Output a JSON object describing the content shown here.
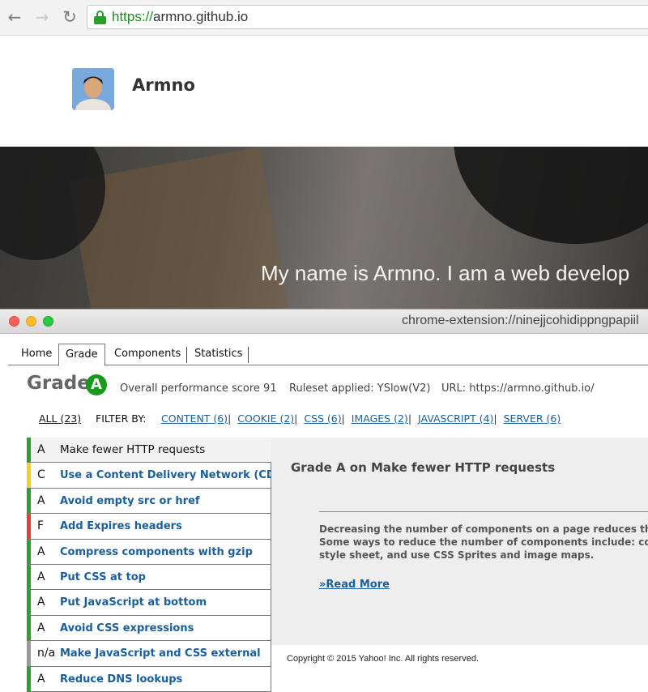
{
  "browser": {
    "url_scheme": "https://",
    "url_host": "armno.github.io",
    "back_icon": "arrow-left-icon",
    "forward_icon": "arrow-right-icon",
    "reload_icon": "reload-icon",
    "lock_icon": "lock-icon"
  },
  "site": {
    "name": "Armno",
    "hero_text": "My name is Armno. I am a web develop"
  },
  "popup": {
    "title": "chrome-extension://ninejjcohidippngpapiil",
    "tabs": [
      "Home",
      "Grade",
      "Components",
      "Statistics"
    ],
    "active_tab": "Grade"
  },
  "grade": {
    "label": "Grade",
    "letter": "A",
    "score_text": "Overall performance score 91",
    "ruleset_text": "Ruleset applied: YSlow(V2)",
    "url_text": "URL: https://armno.github.io/"
  },
  "filter": {
    "all": "ALL (23)",
    "by": "FILTER BY:",
    "links": [
      "CONTENT (6)",
      "COOKIE (2)",
      "CSS (6)",
      "IMAGES (2)",
      "JAVASCRIPT (4)",
      "SERVER (6)"
    ]
  },
  "rules": [
    {
      "grade": "A",
      "label": "Make fewer HTTP requests",
      "color": "#2ba12b",
      "selected": true
    },
    {
      "grade": "C",
      "label": "Use a Content Delivery Network (CDN)",
      "color": "#f0d21c"
    },
    {
      "grade": "A",
      "label": "Avoid empty src or href",
      "color": "#2ba12b"
    },
    {
      "grade": "F",
      "label": "Add Expires headers",
      "color": "#e23c3c"
    },
    {
      "grade": "A",
      "label": "Compress components with gzip",
      "color": "#2ba12b"
    },
    {
      "grade": "A",
      "label": "Put CSS at top",
      "color": "#2ba12b"
    },
    {
      "grade": "A",
      "label": "Put JavaScript at bottom",
      "color": "#2ba12b"
    },
    {
      "grade": "A",
      "label": "Avoid CSS expressions",
      "color": "#2ba12b"
    },
    {
      "grade": "n/a",
      "label": "Make JavaScript and CSS external",
      "color": "#9a9a9a"
    },
    {
      "grade": "A",
      "label": "Reduce DNS lookups",
      "color": "#2ba12b"
    }
  ],
  "detail": {
    "title": "Grade A on Make fewer HTTP requests",
    "body_lines": [
      "Decreasing the number of components on a page reduces the",
      "Some ways to reduce the number of components include: com",
      "style sheet, and use CSS Sprites and image maps."
    ],
    "read_more": "»Read More",
    "copyright": "Copyright © 2015 Yahoo! Inc. All rights reserved."
  }
}
